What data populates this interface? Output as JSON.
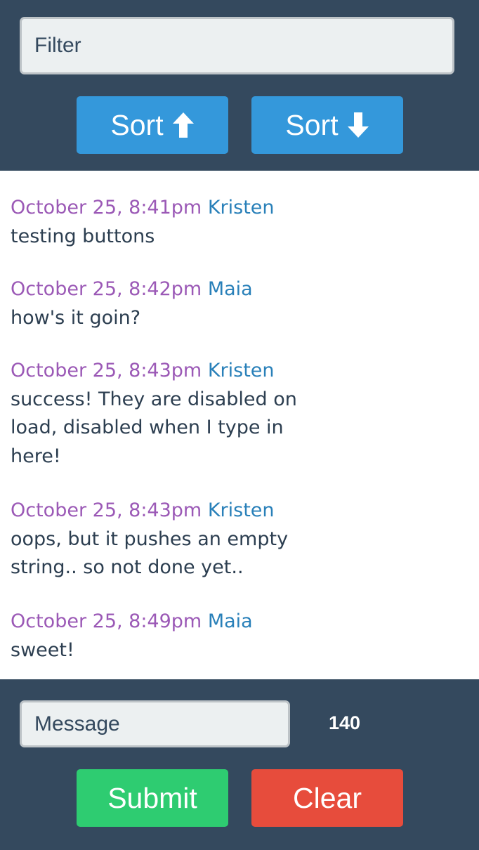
{
  "filter": {
    "placeholder": "Filter"
  },
  "sort_buttons": [
    {
      "label": "Sort",
      "icon": "arrow-up-icon"
    },
    {
      "label": "Sort",
      "icon": "arrow-down-icon"
    }
  ],
  "messages": [
    {
      "time": "October 25, 8:41pm",
      "user": "Kristen",
      "text": "testing buttons"
    },
    {
      "time": "October 25, 8:42pm",
      "user": "Maia",
      "text": "how's it goin?"
    },
    {
      "time": "October 25, 8:43pm",
      "user": "Kristen",
      "text": "success! They are disabled on load, disabled when I type in here!"
    },
    {
      "time": "October 25, 8:43pm",
      "user": "Kristen",
      "text": "oops, but it pushes an empty string.. so not done yet.."
    },
    {
      "time": "October 25, 8:49pm",
      "user": "Maia",
      "text": "sweet!"
    }
  ],
  "composer": {
    "placeholder": "Message",
    "char_count": "140",
    "submit_label": "Submit",
    "clear_label": "Clear"
  },
  "colors": {
    "header_bg": "#34495e",
    "blue_button": "#3498db",
    "submit_green": "#2ecc71",
    "clear_red": "#e74c3c",
    "timestamp": "#9b59b6",
    "username": "#2980b9",
    "text": "#2c3e50"
  }
}
